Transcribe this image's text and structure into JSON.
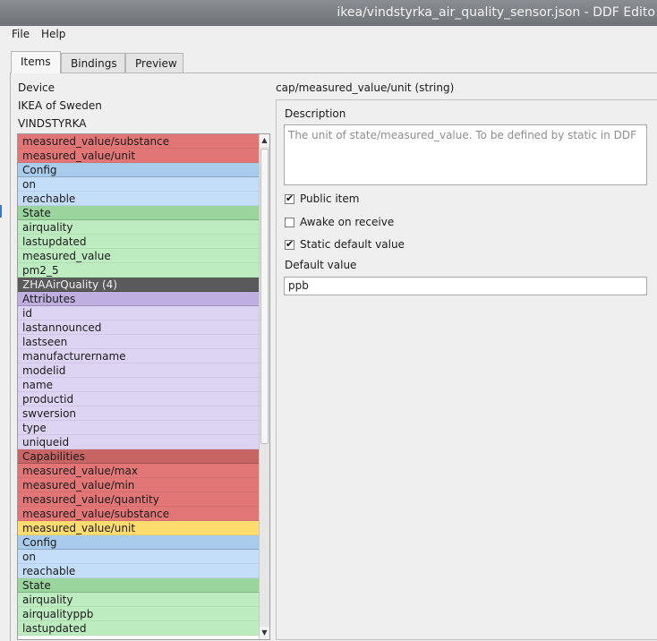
{
  "window": {
    "title": "ikea/vindstyrka_air_quality_sensor.json - DDF Edito"
  },
  "menu": {
    "file": "File",
    "help": "Help"
  },
  "tabs": [
    {
      "label": "Items",
      "active": true
    },
    {
      "label": "Bindings",
      "active": false
    },
    {
      "label": "Preview",
      "active": false
    }
  ],
  "device": {
    "heading": "Device",
    "manufacturer": "IKEA of Sweden",
    "model": "VINDSTYRKA"
  },
  "colors": {
    "capability": "#e27676",
    "config": "#a9cbec",
    "config_item": "#c4defa",
    "state": "#9ad59d",
    "state_item": "#bdecc0",
    "cluster": "#5a5a5a",
    "attributes": "#bfaee0",
    "attribute_item": "#ddd3f2",
    "selected": "#ffdc6e"
  },
  "item_list": [
    {
      "label": "measured_value/substance",
      "kind": "capability"
    },
    {
      "label": "measured_value/unit",
      "kind": "capability"
    },
    {
      "label": "Config",
      "kind": "config"
    },
    {
      "label": "on",
      "kind": "config_item"
    },
    {
      "label": "reachable",
      "kind": "config_item"
    },
    {
      "label": "State",
      "kind": "state"
    },
    {
      "label": "airquality",
      "kind": "state_item"
    },
    {
      "label": "lastupdated",
      "kind": "state_item"
    },
    {
      "label": "measured_value",
      "kind": "state_item"
    },
    {
      "label": "pm2_5",
      "kind": "state_item"
    },
    {
      "label": "ZHAAirQuality (4)",
      "kind": "cluster"
    },
    {
      "label": "Attributes",
      "kind": "attributes"
    },
    {
      "label": "id",
      "kind": "attribute_item"
    },
    {
      "label": "lastannounced",
      "kind": "attribute_item"
    },
    {
      "label": "lastseen",
      "kind": "attribute_item"
    },
    {
      "label": "manufacturername",
      "kind": "attribute_item"
    },
    {
      "label": "modelid",
      "kind": "attribute_item"
    },
    {
      "label": "name",
      "kind": "attribute_item"
    },
    {
      "label": "productid",
      "kind": "attribute_item"
    },
    {
      "label": "swversion",
      "kind": "attribute_item"
    },
    {
      "label": "type",
      "kind": "attribute_item"
    },
    {
      "label": "uniqueid",
      "kind": "attribute_item"
    },
    {
      "label": "Capabilities",
      "kind": "capability_head"
    },
    {
      "label": "measured_value/max",
      "kind": "capability"
    },
    {
      "label": "measured_value/min",
      "kind": "capability"
    },
    {
      "label": "measured_value/quantity",
      "kind": "capability"
    },
    {
      "label": "measured_value/substance",
      "kind": "capability"
    },
    {
      "label": "measured_value/unit",
      "kind": "selected"
    },
    {
      "label": "Config",
      "kind": "config"
    },
    {
      "label": "on",
      "kind": "config_item"
    },
    {
      "label": "reachable",
      "kind": "config_item"
    },
    {
      "label": "State",
      "kind": "state"
    },
    {
      "label": "airquality",
      "kind": "state_item"
    },
    {
      "label": "airqualityppb",
      "kind": "state_item"
    },
    {
      "label": "lastupdated",
      "kind": "state_item"
    }
  ],
  "detail": {
    "title": "cap/measured_value/unit  (string)",
    "description_label": "Description",
    "description_text": "The unit of state/measured_value. To be defined by static in DDF",
    "public_item_label": "Public item",
    "awake_label": "Awake on receive",
    "static_default_label": "Static default value",
    "default_value_label": "Default value",
    "default_value": "ppb"
  },
  "scroll": {
    "up": "▲",
    "down": "▼"
  }
}
